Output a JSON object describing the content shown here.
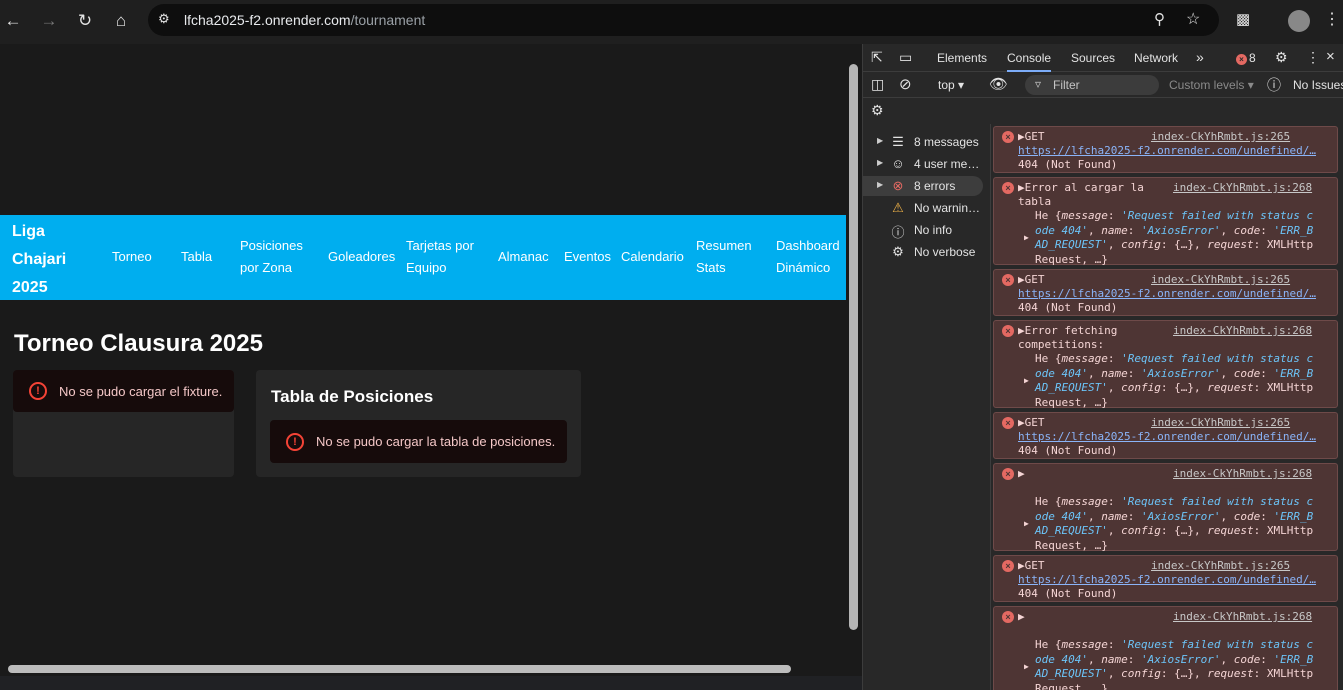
{
  "browser": {
    "url_host": "lfcha2025-f2.onrender.com",
    "url_path": "/tournament"
  },
  "site": {
    "brand": "Liga\nChajari\n2025",
    "nav": [
      "Torneo",
      "Tabla",
      "Posiciones\npor Zona",
      "Goleadores",
      "Tarjetas por\nEquipo",
      "Almanac",
      "Eventos",
      "Calendario",
      "Resumen\nStats",
      "Dashboard\nDinámico"
    ],
    "page_title": "Torneo Clausura 2025",
    "fixture_error": "No se pudo cargar el fixture.",
    "table_title": "Tabla de Posiciones",
    "table_error": "No se pudo cargar la tabla de posiciones."
  },
  "devtools": {
    "tabs": [
      "Elements",
      "Console",
      "Sources",
      "Network"
    ],
    "active_tab": "Console",
    "error_count": "8",
    "context": "top",
    "filter_placeholder": "Filter",
    "levels": "Custom levels",
    "issues": "No Issues",
    "sidebar": [
      {
        "icon": "list-icon",
        "label": "8 messages",
        "expandable": true
      },
      {
        "icon": "user-icon",
        "label": "4 user me…",
        "expandable": true
      },
      {
        "icon": "error-icon",
        "label": "8 errors",
        "expandable": true,
        "selected": true
      },
      {
        "icon": "warning-icon",
        "label": "No warnin…",
        "expandable": false
      },
      {
        "icon": "info-icon",
        "label": "No info",
        "expandable": false
      },
      {
        "icon": "bug-icon",
        "label": "No verbose",
        "expandable": false
      }
    ],
    "log": [
      {
        "kind": "get",
        "l1": "GET",
        "src": "index-CkYhRmbt.js:265",
        "url": "https://lfcha2025-f2.onrender.com/undefined/…",
        "status": "404 (Not Found)"
      },
      {
        "kind": "err",
        "l1": "Error al cargar la",
        "l1b": "tabla",
        "src": "index-CkYhRmbt.js:268"
      },
      {
        "kind": "get",
        "l1": "GET",
        "src": "index-CkYhRmbt.js:265",
        "url": "https://lfcha2025-f2.onrender.com/undefined/…",
        "status": "404 (Not Found)"
      },
      {
        "kind": "err",
        "l1": "Error fetching",
        "l1b": "competitions:",
        "src": "index-CkYhRmbt.js:268"
      },
      {
        "kind": "get",
        "l1": "GET",
        "src": "index-CkYhRmbt.js:265",
        "url": "https://lfcha2025-f2.onrender.com/undefined/…",
        "status": "404 (Not Found)"
      },
      {
        "kind": "err",
        "l1": "",
        "l1b": "",
        "src": "index-CkYhRmbt.js:268"
      },
      {
        "kind": "get",
        "l1": "GET",
        "src": "index-CkYhRmbt.js:265",
        "url": "https://lfcha2025-f2.onrender.com/undefined/…",
        "status": "404 (Not Found)"
      },
      {
        "kind": "err",
        "l1": "",
        "l1b": "",
        "src": "index-CkYhRmbt.js:268"
      }
    ],
    "axios_lines": [
      [
        "He {",
        "message",
        ": ",
        "'Request failed with status c"
      ],
      [
        "ode 404'",
        ", ",
        "name",
        ": ",
        "'AxiosError'",
        ", ",
        "code",
        ": ",
        "'ERR_B"
      ],
      [
        "AD_REQUEST'",
        ", ",
        "config",
        ": {…}, ",
        "request",
        ": XMLHttp"
      ],
      [
        "Request, …}"
      ]
    ]
  }
}
